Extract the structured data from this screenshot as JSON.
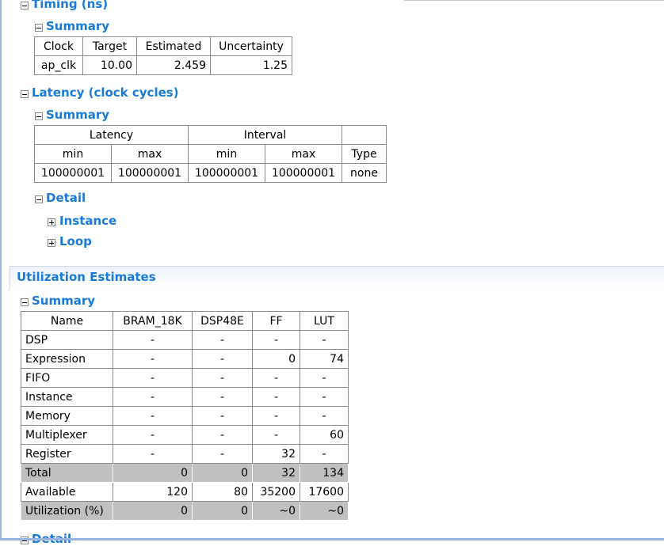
{
  "timing": {
    "heading": "Timing (ns)",
    "summary": "Summary",
    "headers": [
      "Clock",
      "Target",
      "Estimated",
      "Uncertainty"
    ],
    "rows": [
      [
        "ap_clk",
        "10.00",
        "2.459",
        "1.25"
      ]
    ]
  },
  "latency": {
    "heading": "Latency (clock cycles)",
    "summary": "Summary",
    "group_headers": [
      "Latency",
      "Interval"
    ],
    "headers": [
      "min",
      "max",
      "min",
      "max",
      "Type"
    ],
    "rows": [
      [
        "100000001",
        "100000001",
        "100000001",
        "100000001",
        "none"
      ]
    ],
    "detail": "Detail",
    "instance": "Instance",
    "loop": "Loop"
  },
  "utilization": {
    "title": "Utilization Estimates",
    "summary": "Summary",
    "detail": "Detail",
    "headers": [
      "Name",
      "BRAM_18K",
      "DSP48E",
      "FF",
      "LUT"
    ],
    "rows": [
      [
        "DSP",
        "-",
        "-",
        "-",
        "-"
      ],
      [
        "Expression",
        "-",
        "-",
        "0",
        "74"
      ],
      [
        "FIFO",
        "-",
        "-",
        "-",
        "-"
      ],
      [
        "Instance",
        "-",
        "-",
        "-",
        "-"
      ],
      [
        "Memory",
        "-",
        "-",
        "-",
        "-"
      ],
      [
        "Multiplexer",
        "-",
        "-",
        "-",
        "60"
      ],
      [
        "Register",
        "-",
        "-",
        "32",
        "-"
      ],
      [
        "Total",
        "0",
        "0",
        "32",
        "134"
      ],
      [
        "Available",
        "120",
        "80",
        "35200",
        "17600"
      ],
      [
        "Utilization (%)",
        "0",
        "0",
        "~0",
        "~0"
      ]
    ]
  },
  "colors": {
    "heading": "#1a7ad8",
    "total_row": "#c0c0c0"
  }
}
